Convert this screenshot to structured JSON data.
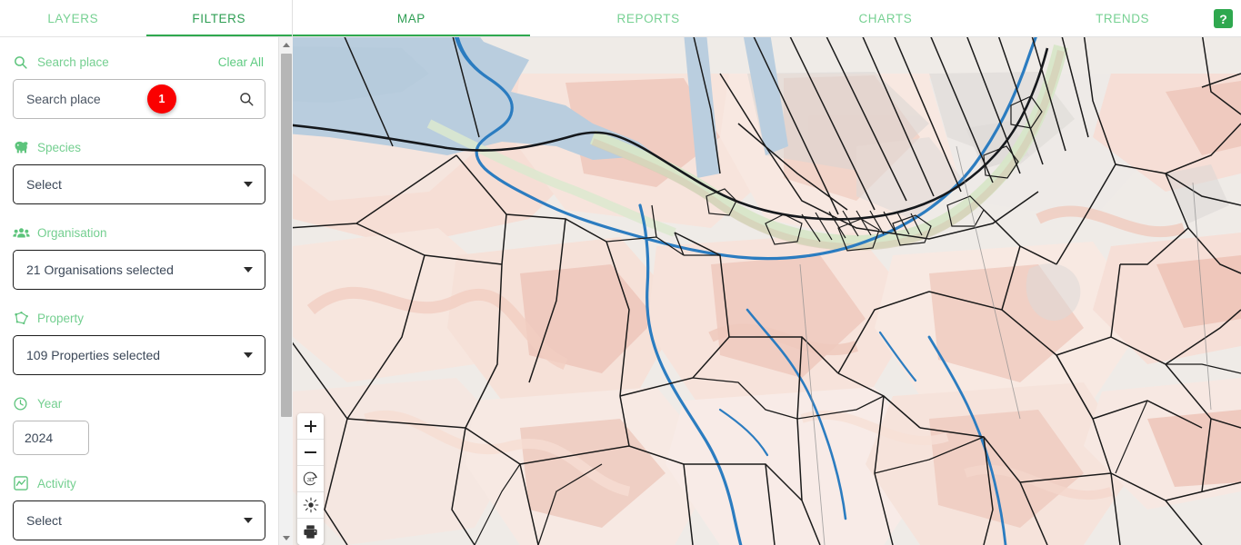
{
  "topbar": {
    "left_tabs": [
      {
        "label": "LAYERS",
        "active": false,
        "name": "tab-layers"
      },
      {
        "label": "FILTERS",
        "active": true,
        "name": "tab-filters"
      }
    ],
    "right_tabs": [
      {
        "label": "MAP",
        "active": true,
        "name": "tab-map"
      },
      {
        "label": "REPORTS",
        "active": false,
        "name": "tab-reports"
      },
      {
        "label": "CHARTS",
        "active": false,
        "name": "tab-charts"
      },
      {
        "label": "TRENDS",
        "active": false,
        "name": "tab-trends"
      }
    ],
    "help_label": "?"
  },
  "sidebar": {
    "clear_all_label": "Clear All",
    "search": {
      "section_label": "Search place",
      "icon": "search-icon",
      "placeholder": "Search place",
      "value": "",
      "badge_count": "1"
    },
    "species": {
      "section_label": "Species",
      "icon": "species-icon",
      "value": "Select"
    },
    "organisation": {
      "section_label": "Organisation",
      "icon": "group-icon",
      "value": "21 Organisations selected"
    },
    "property": {
      "section_label": "Property",
      "icon": "polygon-icon",
      "value": "109 Properties selected"
    },
    "year": {
      "section_label": "Year",
      "icon": "clock-icon",
      "value": "2024"
    },
    "activity": {
      "section_label": "Activity",
      "icon": "activity-chart-icon",
      "value": "Select"
    }
  },
  "map": {
    "controls": [
      {
        "name": "zoom-in-button",
        "icon": "plus-icon"
      },
      {
        "name": "zoom-out-button",
        "icon": "minus-icon"
      },
      {
        "name": "rotate-3d-button",
        "icon": "3d-rotate-icon"
      },
      {
        "name": "brightness-button",
        "icon": "sun-icon"
      },
      {
        "name": "print-button",
        "icon": "printer-icon"
      }
    ],
    "colors": {
      "land": "#efebe7",
      "water": "#b9cdde",
      "river": "#2b7cc0",
      "heat_light": "#f8e2da",
      "heat_mid": "#f2cdc2",
      "heat_strong": "#e9b7ab",
      "vegetation": "#d9e7cc",
      "parcel_boundary": "#1a1a1a",
      "urban_gray": "#dcd8d6"
    }
  },
  "theme": {
    "green_active": "#2e9e53",
    "green_light": "#77d193",
    "green_accent": "#2fa84f",
    "badge_red": "#fa0000"
  }
}
